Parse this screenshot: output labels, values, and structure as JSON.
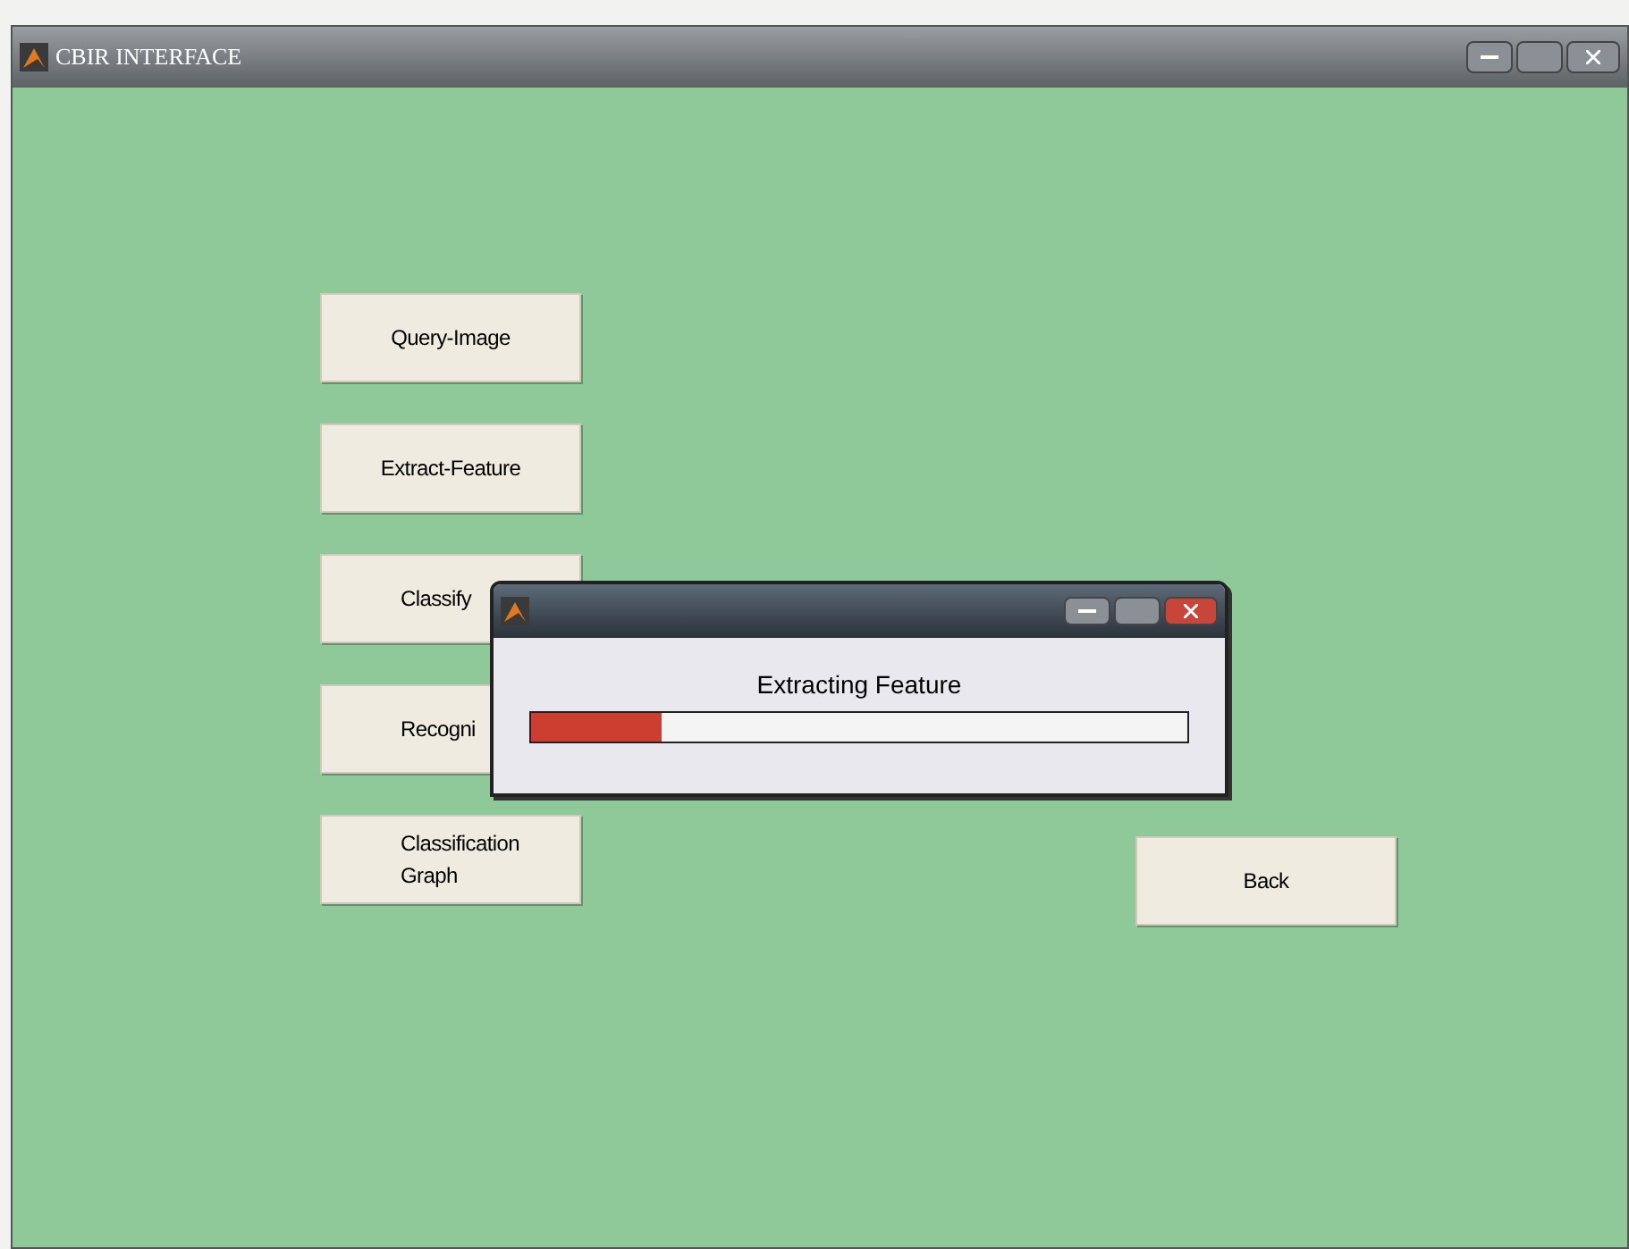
{
  "window": {
    "title": "CBIR INTERFACE"
  },
  "buttons": [
    {
      "label": "Query-Image"
    },
    {
      "label": "Extract-Feature"
    },
    {
      "label": "Classify"
    },
    {
      "label": "Recogni"
    },
    {
      "label": "Classification Graph"
    }
  ],
  "back_button": {
    "label": "Back"
  },
  "progress_dialog": {
    "message": "Extracting Feature",
    "level": 0.2
  }
}
